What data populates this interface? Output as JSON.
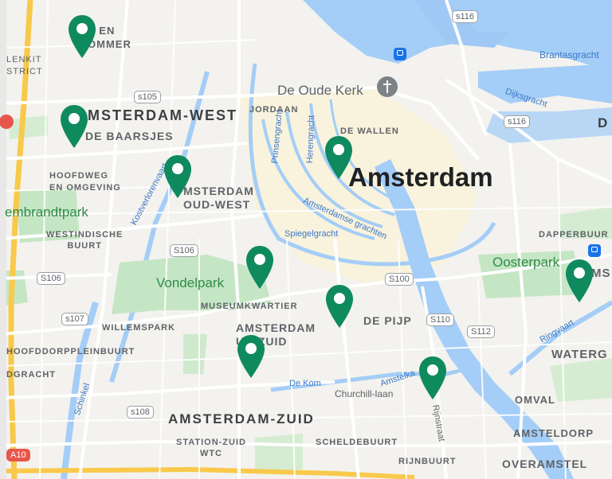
{
  "map": {
    "labels": {
      "bos_en_lommer": "S EN\nOMMER",
      "slotervaart_fragment": "LENKIT\nSTRICT",
      "amsterdam_west": "MSTERDAM-WEST",
      "de_baarsjes": "DE BAARSJES",
      "hoofdweg": "HOOFDWEG\nEN OMGEVING",
      "rembrandtpark": "embrandtpark",
      "westindische": "WESTINDISCHE\nBUURT",
      "jordaan": "JORDAAN",
      "de_oude_kerk": "De Oude Kerk",
      "de_wallen": "DE WALLEN",
      "amsterdam": "Amsterdam",
      "oud_west": "MSTERDAM\nOUD-WEST",
      "prinsengracht": "Prinsengracht",
      "herengracht": "Herengracht",
      "kostverlorenvaart": "Kostverlorenvaart",
      "amsterdamse_grachten": "Amsterdamse grachten",
      "spiegelgracht": "Spiegelgracht",
      "vondelpark": "Vondelpark",
      "museumkwartier": "MUSEUMKWARTIER",
      "willemspark": "WILLEMSPARK",
      "amsterdam_oud_zuid": "AMSTERDAM\nUD-ZUID",
      "de_pijp": "DE PIJP",
      "hoofddorpplein": "HOOFDDORPPLEINBUURT",
      "dgracht": "DGRACHT",
      "schinkel": "Schinkel",
      "de_kom": "De Kom",
      "churchill_laan": "Churchill-laan",
      "amstelkanaal": "Amstelka",
      "amsterdam_zuid": "AMSTERDAM-ZUID",
      "station_zuid": "STATION-ZUID\nWTC",
      "scheldebuurt": "SCHELDEBUURT",
      "rijnstraat": "Rijnstraat",
      "rijnbuurt": "RIJNBUURT",
      "dapperbuurt": "DAPPERBUUR",
      "oosterpark": "Oosterpark",
      "ams_fragment": "MS",
      "watergraafsmeer": "WATERG",
      "omval": "OMVAL",
      "amsteldorp": "AMSTELDORP",
      "overamstel": "OVERAMSTEL",
      "ringvaart": "Ringvaart",
      "brantasgracht": "Brantasgracht",
      "dijksgracht": "Dijksgracht",
      "d_fragment": "D"
    },
    "shields": {
      "s116_top": "s116",
      "s116_mid": "s116",
      "s105": "s105",
      "s106_a": "S106",
      "s106_b": "S106",
      "s107": "s107",
      "s108": "s108",
      "s100": "S100",
      "s110": "S110",
      "s112": "S112",
      "a10": "A10"
    },
    "pin_color": "#0f8a5f",
    "park_color": "#c5e6c4",
    "water_color": "#a4cdf7",
    "road_color": "#ffffff",
    "highway_color": "#f8c94a"
  }
}
